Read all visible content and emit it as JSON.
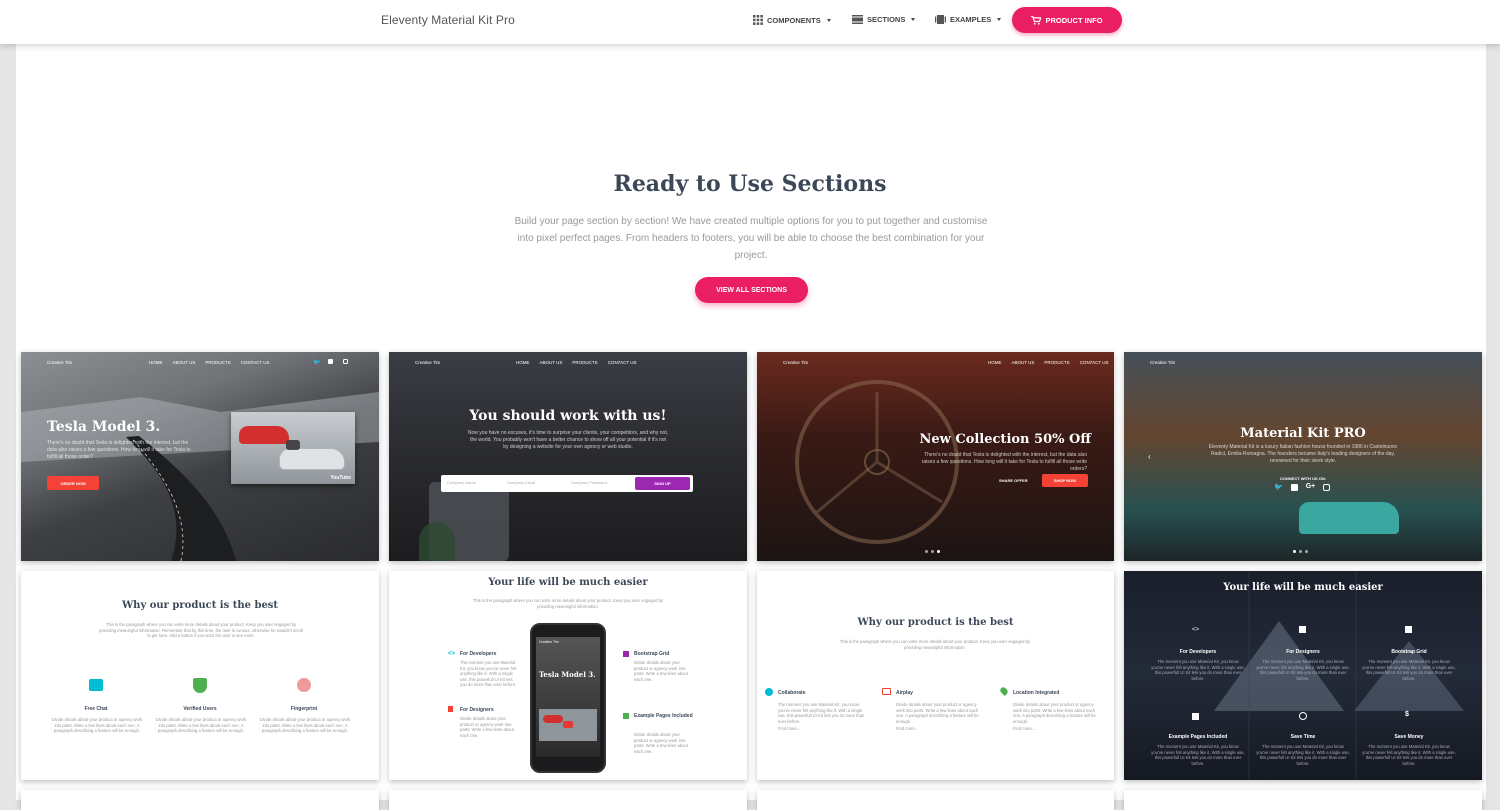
{
  "navbar": {
    "brand": "Eleventy Material Kit Pro",
    "items": [
      {
        "label": "COMPONENTS",
        "icon": "grid-icon"
      },
      {
        "label": "SECTIONS",
        "icon": "view-day-icon"
      },
      {
        "label": "EXAMPLES",
        "icon": "collections-icon"
      }
    ],
    "cta": {
      "label": "PRODUCT INFO",
      "icon": "cart-icon"
    }
  },
  "section": {
    "title": "Ready to Use Sections",
    "description": "Build your page section by section! We have created multiple options for you to put together and customise into pixel perfect pages. From headers to footers, you will be able to choose the best combination for your project.",
    "button": "VIEW ALL SECTIONS"
  },
  "cards": {
    "tesla": {
      "brand": "Creative Tim",
      "links": [
        "HOME",
        "ABOUT US",
        "PRODUCTS",
        "CONTACT US"
      ],
      "title": "Tesla Model 3.",
      "text": "There's no doubt that Tesla is delighted with the interest, but the data also raises a few questions. How long will it take for Tesla to fulfill all those order?",
      "button": "ORDER NOW",
      "video_logo": "YouTube"
    },
    "work": {
      "brand": "Creative Tim",
      "links": [
        "HOME",
        "ABOUT US",
        "PRODUCTS",
        "CONTACT US"
      ],
      "title": "You should work with us!",
      "text": "Now you have no excuses, it's time to surprise your clients, your competitors, and why not, the world. You probably won't have a better chance to show off all your potential if it's not by designing a website for your own agency or web studio.",
      "fields": [
        "Company Name",
        "Company Email",
        "Company Password"
      ],
      "button": "SIGN UP"
    },
    "collection": {
      "brand": "Creative Tim",
      "links": [
        "HOME",
        "ABOUT US",
        "PRODUCTS",
        "CONTACT US"
      ],
      "title": "New Collection 50% Off",
      "text": "There's no doubt that Tesla is delighted with the interest, but the data also raises a few questions. How long will it take for Tesla to fulfill all those write orders?",
      "share": "SHARE OFFER",
      "button": "SHOP NOW"
    },
    "kitpro": {
      "brand": "Creative Tim",
      "title": "Material Kit PRO",
      "text": "Eleventy Material Kit is a luxury Italian fashion house founded in 1986 in Castelnuovo Radici, Emilia-Romagna. The founders became Italy's leading designers of the day, renowned for their sleek style.",
      "follow": "CONNECT WITH US ON:",
      "social": [
        "twitter",
        "facebook",
        "G+",
        "instagram"
      ]
    },
    "features1": {
      "title": "Why our product is the best",
      "text": "This is the paragraph where you can write more details about your product. Keep you user engaged by providing meaningful information. Remember that by this time, the user is curious, otherwise he wouldn't scroll to get here. Add a button if you want the user to see more.",
      "items": [
        {
          "title": "Free Chat",
          "text": "Divide details about your product or agency work into parts. Write a few lines about each one. A paragraph describing a feature will be enough."
        },
        {
          "title": "Verified Users",
          "text": "Divide details about your product or agency work into parts. Write a few lines about each one. A paragraph describing a feature will be enough."
        },
        {
          "title": "Fingerprint",
          "text": "Divide details about your product or agency work into parts. Write a few lines about each one. A paragraph describing a feature will be enough."
        }
      ]
    },
    "features2": {
      "title": "Your life will be much easier",
      "text": "This is the paragraph where you can write more details about your product. Keep you user engaged by providing meaningful information.",
      "phone_title": "Tesla Model 3.",
      "phone_brand": "Creative Tim",
      "items": [
        {
          "title": "For Developers",
          "text": "The moment you use Material Kit, you know you've never felt anything like it. With a single use, this powerfull UI Kit lets you do more than ever before."
        },
        {
          "title": "For Designers",
          "text": "Divide details about your product or agency work into parts. Write a few lines about each one."
        },
        {
          "title": "Bootstrap Grid",
          "text": "Divide details about your product or agency work into parts. Write a few lines about each one."
        },
        {
          "title": "Example Pages Included",
          "text": "Divide details about your product or agency work into parts. Write a few lines about each one."
        }
      ]
    },
    "features3": {
      "title": "Why our product is the best",
      "text": "This is the paragraph where you can write more details about your product. Keep you user engaged by providing meaningful information.",
      "items": [
        {
          "title": "Collaborate",
          "text": "The moment you use Material Kit, you know you've never felt anything like it. With a single use, this powerfull UI Kit lets you do more than ever before.",
          "more": "Find more..."
        },
        {
          "title": "Airplay",
          "text": "Divide details about your product or agency work into parts. Write a few lines about each one. A paragraph describing a feature will be enough.",
          "more": "Find more..."
        },
        {
          "title": "Location Integrated",
          "text": "Divide details about your product or agency work into parts. Write a few lines about each one. A paragraph describing a feature will be enough.",
          "more": "Find more..."
        }
      ]
    },
    "features4": {
      "title": "Your life will be much easier",
      "items": [
        {
          "title": "For Developers",
          "text": "The moment you use Material Kit, you know you've never felt anything like it. With a single use, this powerfull UI Kit lets you do more than ever before."
        },
        {
          "title": "For Designers",
          "text": "The moment you use Material Kit, you know you've never felt anything like it. With a single use, this powerfull UI Kit lets you do more than ever before."
        },
        {
          "title": "Bootstrap Grid",
          "text": "The moment you use Material Kit, you know you've never felt anything like it. With a single use, this powerfull UI Kit lets you do more than ever before."
        },
        {
          "title": "Example Pages Included",
          "text": "The moment you use Material Kit, you know you've never felt anything like it. With a single use, this powerfull UI Kit lets you do more than ever before."
        },
        {
          "title": "Save Time",
          "text": "The moment you use Material Kit, you know you've never felt anything like it. With a single use, this powerfull UI Kit lets you do more than ever before."
        },
        {
          "title": "Save Money",
          "text": "The moment you use Material Kit, you know you've never felt anything like it. With a single use, this powerfull UI Kit lets you do more than ever before."
        }
      ]
    }
  },
  "colors": {
    "accent": "#e91e63",
    "orange": "#f44336",
    "purple": "#9c27b0",
    "text": "#3c4858"
  }
}
